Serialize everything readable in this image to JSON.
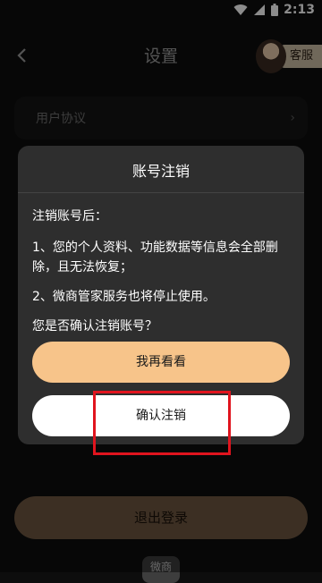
{
  "status_bar": {
    "time": "2:13",
    "icons": [
      "wifi-icon",
      "signal-icon",
      "battery-icon"
    ]
  },
  "header": {
    "back_icon": "back-chevron-icon",
    "title": "设置",
    "service_label": "客服"
  },
  "settings_list": {
    "items": [
      {
        "label": "用户协议",
        "chevron": "›"
      }
    ]
  },
  "dialog": {
    "title": "账号注销",
    "lead": "注销账号后：",
    "points": [
      "1、您的个人资料、功能数据等信息会全部删除，且无法恢复；",
      "2、微商管家服务也将停止使用。"
    ],
    "question": "您是否确认注销账号？",
    "reconsider_label": "我再看看",
    "confirm_label": "确认注销"
  },
  "footer": {
    "logout_label": "退出登录",
    "logo_text": "微商"
  },
  "colors": {
    "accent": "#f7c48a",
    "dialog_bg": "#2e2e2e",
    "highlight": "#e0141e"
  }
}
